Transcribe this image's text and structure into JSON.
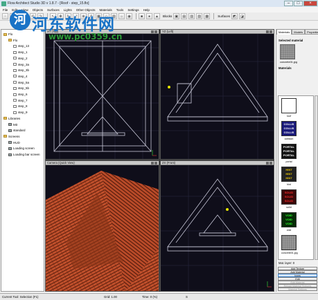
{
  "window": {
    "title": "Flow Architect Studio 3D v 1.8.7 - [Roof - step_15.flo]"
  },
  "menu": [
    "File",
    "Edit",
    "View",
    "Objects",
    "Surfaces",
    "Lights",
    "Other Objects",
    "Materials",
    "Tools",
    "Settings",
    "Help"
  ],
  "toolbar": {
    "blocks_label": "Blocks",
    "surfaces_label": "Surfaces"
  },
  "watermark": {
    "logo_char": "河",
    "name": "河东软件网",
    "url": "www.pc0359.cn"
  },
  "tree": {
    "items": [
      {
        "label": "Flo",
        "kind": "folder",
        "indent": 0
      },
      {
        "label": "Flo",
        "kind": "folder",
        "indent": 1
      },
      {
        "label": "step_13",
        "kind": "file",
        "indent": 2
      },
      {
        "label": "step_1",
        "kind": "file",
        "indent": 2
      },
      {
        "label": "step_2",
        "kind": "file",
        "indent": 2
      },
      {
        "label": "step_3a",
        "kind": "file",
        "indent": 2
      },
      {
        "label": "step_3b",
        "kind": "file",
        "indent": 2
      },
      {
        "label": "step_4",
        "kind": "file",
        "indent": 2
      },
      {
        "label": "step_5a",
        "kind": "file",
        "indent": 2
      },
      {
        "label": "step_5b",
        "kind": "file",
        "indent": 2
      },
      {
        "label": "step_6",
        "kind": "file",
        "indent": 2
      },
      {
        "label": "step_7",
        "kind": "file",
        "indent": 2
      },
      {
        "label": "step_8",
        "kind": "file",
        "indent": 2
      },
      {
        "label": "step_9",
        "kind": "file",
        "indent": 2
      },
      {
        "label": "Libraries",
        "kind": "folder",
        "indent": 0
      },
      {
        "label": "Mit",
        "kind": "pic",
        "indent": 1
      },
      {
        "label": "standard",
        "kind": "pic",
        "indent": 1
      },
      {
        "label": "Screens",
        "kind": "folder",
        "indent": 0
      },
      {
        "label": "HUD",
        "kind": "pic",
        "indent": 1
      },
      {
        "label": "Loading screen",
        "kind": "pic",
        "indent": 1
      },
      {
        "label": "Loading bar screen",
        "kind": "pic",
        "indent": 1
      }
    ]
  },
  "viewports": {
    "top": {
      "title": "XY (Top)"
    },
    "left": {
      "title": "YZ (Left)"
    },
    "camera": {
      "title": "Camera (Quick View)"
    },
    "front": {
      "title": "ZX (Front)"
    }
  },
  "right_panel": {
    "tabs": [
      "Materials",
      "Models",
      "Properties"
    ],
    "selected_label": "Selected material",
    "selected_name": "concrete01.jpg",
    "materials_label": "Materials",
    "materials": [
      {
        "name": "roof",
        "lines": [],
        "bg": "#ffffff",
        "fg": "#000000"
      },
      {
        "name": "collision",
        "lines": [
          "COLLIS",
          "COLLIS",
          "COLLIS"
        ],
        "bg": "#1a1a7a",
        "fg": "#ffffff"
      },
      {
        "name": "portal",
        "lines": [
          "PORTAL",
          "PORTAL",
          "PORTAL"
        ],
        "bg": "#111111",
        "fg": "#ffffff"
      },
      {
        "name": "hint",
        "lines": [
          "HINT",
          "HINT",
          "HINT"
        ],
        "bg": "#222222",
        "fg": "#e8c400"
      },
      {
        "name": "solid",
        "lines": [
          "SOLID",
          "SOLID",
          "SOLID"
        ],
        "bg": "#3a0808",
        "fg": "#ff2a2a"
      },
      {
        "name": "void",
        "lines": [
          "VOID",
          "VOID",
          "VOID"
        ],
        "bg": "#062c06",
        "fg": "#2aff2a"
      },
      {
        "name": "concrete01.jpg",
        "lines": [],
        "bg": "#9a9a9a",
        "fg": "#000000"
      }
    ],
    "mat_layer": "Mat. layer:  0",
    "buttons": [
      {
        "label": "Add Texture",
        "state": "normal"
      },
      {
        "label": "Add Material",
        "state": "normal"
      },
      {
        "label": "Icons",
        "state": "active"
      },
      {
        "label": "Edit",
        "state": "normal"
      },
      {
        "label": "Edit Material",
        "state": "disabled"
      },
      {
        "label": "Reload Material Textures",
        "state": "disabled"
      },
      {
        "label": "Material Settings",
        "state": "disabled"
      }
    ]
  },
  "status": {
    "tool": "Current Tool: Selection (F1)",
    "grid": "Grid: 1.00",
    "time": "Time: 0 (%)",
    "extra": "S"
  },
  "colors": {
    "wire": "#c8c8d8",
    "yellow": "#e8e800",
    "roof": "#c0502c"
  }
}
